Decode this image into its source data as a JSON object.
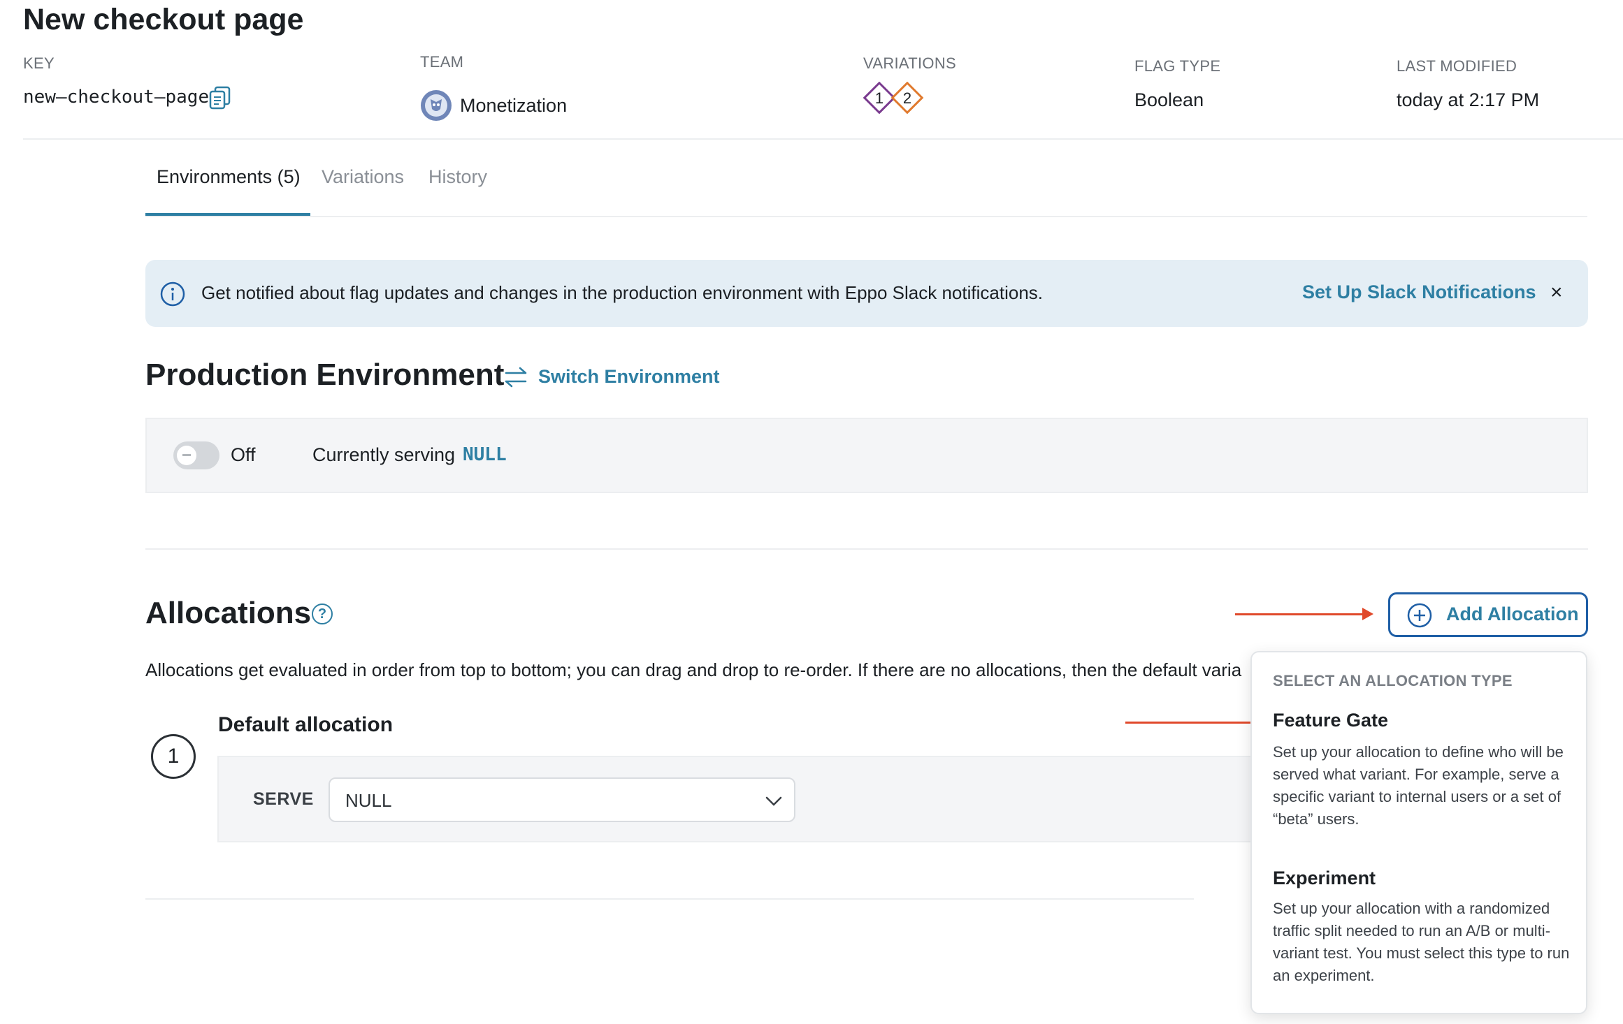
{
  "page": {
    "title": "New checkout page"
  },
  "meta": {
    "key_label": "KEY",
    "key_value": "new–checkout–page",
    "team_label": "TEAM",
    "team_value": "Monetization",
    "variations_label": "VARIATIONS",
    "variations": [
      "1",
      "2"
    ],
    "variation_colors": [
      "#7a3b8f",
      "#e07a2e"
    ],
    "flag_type_label": "FLAG TYPE",
    "flag_type_value": "Boolean",
    "last_modified_label": "LAST MODIFIED",
    "last_modified_value": "today at 2:17 PM"
  },
  "tabs": [
    {
      "label": "Environments (5)",
      "active": true
    },
    {
      "label": "Variations",
      "active": false
    },
    {
      "label": "History",
      "active": false
    }
  ],
  "banner": {
    "text": "Get notified about flag updates and changes in the production environment with Eppo Slack notifications.",
    "link": "Set Up Slack Notifications",
    "close": "×"
  },
  "environment": {
    "title": "Production Environment",
    "switch_label": "Switch Environment",
    "toggle_state": "Off",
    "serving_label": "Currently serving",
    "serving_value": "NULL"
  },
  "allocations": {
    "title": "Allocations",
    "help_glyph": "?",
    "description": "Allocations get evaluated in order from top to bottom; you can drag and drop to re-order. If there are no allocations, then the default varia",
    "add_button": "Add Allocation",
    "default": {
      "step": "1",
      "title": "Default allocation",
      "serve_label": "SERVE",
      "serve_value": "NULL"
    }
  },
  "dropdown": {
    "header": "SELECT AN ALLOCATION TYPE",
    "options": [
      {
        "title": "Feature Gate",
        "description": "Set up your allocation to define who will be served what variant. For example, serve a specific variant to internal users or a set of “beta” users."
      },
      {
        "title": "Experiment",
        "description": "Set up your allocation with a randomized traffic split needed to run an A/B or multi-variant test. You must select this type to run an experiment."
      }
    ]
  },
  "colors": {
    "accent": "#2e7fa3",
    "button_border": "#1f5fa6",
    "annotation_arrow": "#e0492b",
    "banner_bg": "#e4eef5"
  },
  "icons": [
    "copy-icon",
    "team-avatar-icon",
    "info-icon",
    "close-icon",
    "switch-arrows-icon",
    "help-icon",
    "plus-circle-icon",
    "chevron-down-icon"
  ]
}
